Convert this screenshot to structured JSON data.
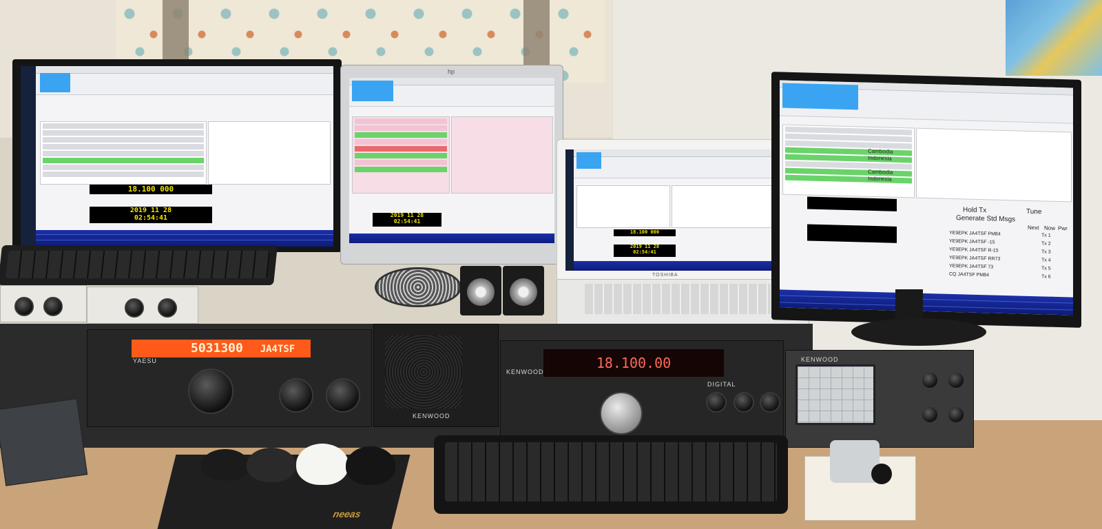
{
  "monitor_left": {
    "freq": "18.100 000",
    "date": "2019 11 28",
    "time": "02:54:41"
  },
  "monitor_hp": {
    "brand": "hp",
    "date": "2019 11 28",
    "time": "02:54:41"
  },
  "monitor_right": {
    "decodes": [
      {
        "text": "Cambodia"
      },
      {
        "text": "Indonesia"
      },
      {
        "text": "Cambodia"
      },
      {
        "text": "Indonesia"
      }
    ],
    "tx_messages": [
      "YE9EPK JA4TSF PM84",
      "YE9EPK JA4TSF -15",
      "YE9EPK JA4TSF R-15",
      "YE9EPK JA4TSF RR73",
      "YE9EPK JA4TSF 73",
      "CQ JA4TSF PM84"
    ],
    "tx_buttons": [
      "Tx 1",
      "Tx 2",
      "Tx 3",
      "Tx 4",
      "Tx 5",
      "Tx 6"
    ],
    "labels": {
      "generate": "Generate Std Msgs",
      "hold_tx": "Hold Tx",
      "tune": "Tune",
      "next": "Next",
      "now": "Now",
      "pwr": "Pwr"
    }
  },
  "laptop": {
    "brand": "TOSHIBA",
    "freq": "18.100 000",
    "date": "2019 11 28",
    "time": "02:54:41"
  },
  "rig_ft950": {
    "brand": "YAESU",
    "freq": "5031300",
    "call": "JA4TSF"
  },
  "rig_ts850": {
    "brand": "KENWOOD",
    "freq": "18.100.00",
    "label": "DIGITAL"
  },
  "speaker_sp": {
    "brand": "KENWOOD"
  },
  "scope": {
    "brand": "KENWOOD"
  },
  "mousepad": {
    "brand": "neeas"
  },
  "colors": {
    "waterfall": "#1b2fa8",
    "decode_green": "#6ad36a",
    "freq_yellow": "#f2e600",
    "rig_orange": "#ff5a1a"
  }
}
